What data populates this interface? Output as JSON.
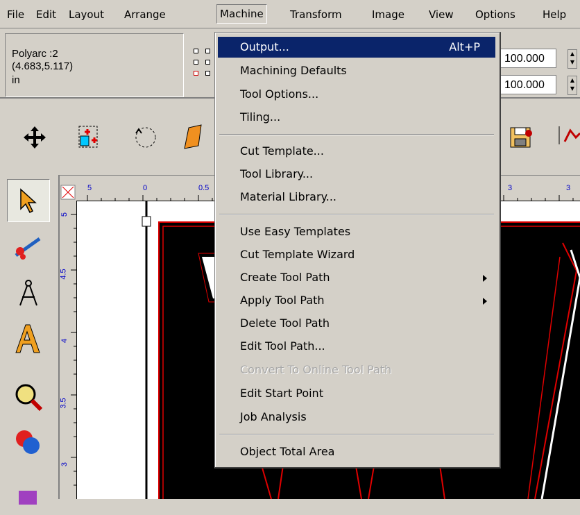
{
  "menubar": {
    "items": [
      {
        "label": "File"
      },
      {
        "label": "Edit"
      },
      {
        "label": "Layout"
      },
      {
        "label": "Arrange"
      },
      {
        "label": "Machine"
      },
      {
        "label": "Transform"
      },
      {
        "label": "Image"
      },
      {
        "label": "View"
      },
      {
        "label": "Options"
      },
      {
        "label": "Help"
      }
    ],
    "active": "Machine"
  },
  "selection_info": {
    "object": "Polyarc :2",
    "position": "(4.683,5.117)",
    "unit": "in"
  },
  "size_fields": {
    "width": "100.000",
    "height": "100.000"
  },
  "rulers": {
    "horizontal_ticks": [
      "5",
      "0",
      "0.5",
      "3",
      "3"
    ],
    "vertical_ticks": [
      "5",
      "4.5",
      "4",
      "3.5",
      "3"
    ]
  },
  "machine_menu": {
    "items": [
      {
        "label": "Output...",
        "shortcut": "Alt+P",
        "highlighted": true
      },
      {
        "label": "Machining Defaults"
      },
      {
        "label": "Tool Options..."
      },
      {
        "label": "Tiling..."
      },
      {
        "separator": true
      },
      {
        "label": "Cut Template..."
      },
      {
        "label": "Tool Library..."
      },
      {
        "label": "Material Library..."
      },
      {
        "separator": true
      },
      {
        "label": "Use Easy Templates"
      },
      {
        "label": "Cut Template Wizard"
      },
      {
        "label": "Create Tool Path",
        "submenu": true
      },
      {
        "label": "Apply Tool Path",
        "submenu": true
      },
      {
        "label": "Delete Tool Path"
      },
      {
        "label": "Edit Tool Path..."
      },
      {
        "label": "Convert To Online Tool Path",
        "disabled": true
      },
      {
        "label": "Edit Start Point"
      },
      {
        "label": "Job Analysis"
      },
      {
        "separator": true
      },
      {
        "label": "Object Total Area"
      }
    ]
  },
  "colors": {
    "highlight": "#0a246a",
    "chrome": "#d4d0c8"
  },
  "icons": [
    "move-icon",
    "node-edit-icon",
    "rotate-icon",
    "skew-icon",
    "save-icon",
    "output-icon",
    "select-arrow-icon",
    "knife-icon",
    "compass-icon",
    "text-icon",
    "zoom-icon",
    "fill-icon",
    "shape-icon"
  ]
}
